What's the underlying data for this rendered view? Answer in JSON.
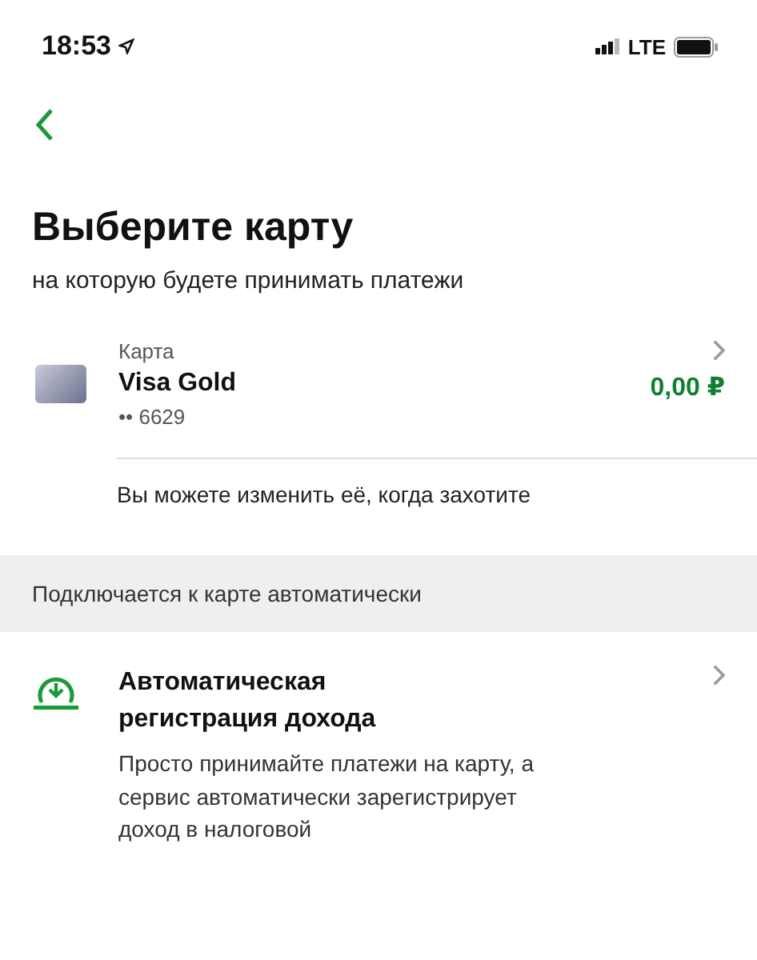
{
  "status_bar": {
    "time": "18:53",
    "network": "LTE"
  },
  "title": "Выберите карту",
  "subtitle": "на которую будете принимать платежи",
  "card": {
    "label": "Карта",
    "name": "Visa Gold",
    "number": "•• 6629",
    "balance": "0,00 ₽"
  },
  "note": "Вы можете изменить её, когда захотите",
  "section_header": "Подключается к карте автоматически",
  "feature": {
    "title": "Автоматическая регистрация дохода",
    "description": "Просто принимайте платежи на карту, а сервис автоматически зарегистрирует доход в налоговой"
  }
}
